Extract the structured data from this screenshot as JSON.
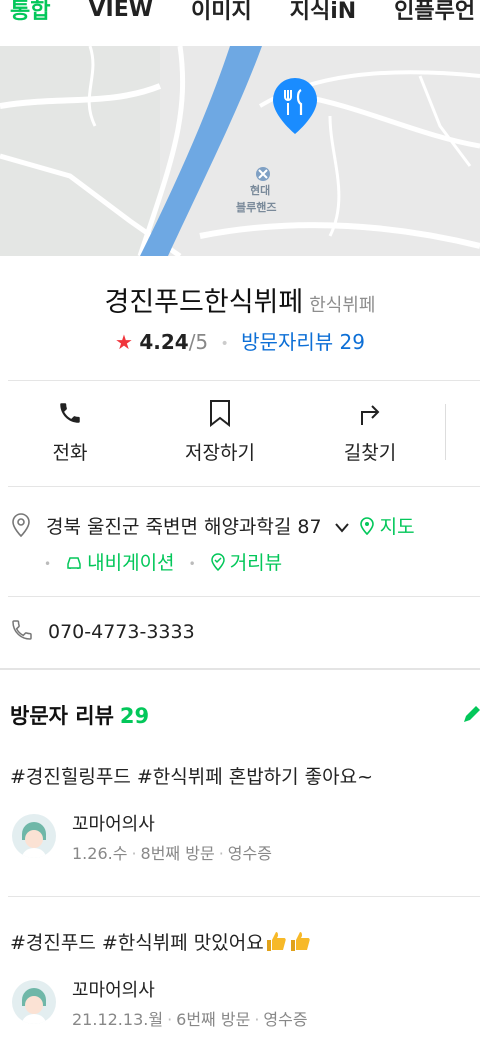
{
  "tabs": [
    "통합",
    "VIEW",
    "이미지",
    "지식iN",
    "인플루언"
  ],
  "map": {
    "label_line1": "현대",
    "label_line2": "블루핸즈"
  },
  "place": {
    "name": "경진푸드한식뷔페",
    "category": "한식뷔페",
    "rating": "4.24",
    "rating_max": "/5",
    "visitor_reviews": "방문자리뷰 29"
  },
  "actions": {
    "call": "전화",
    "save": "저장하기",
    "directions": "길찾기"
  },
  "address": {
    "text": "경북 울진군 죽변면 해양과학길 87",
    "map_link": "지도",
    "navigation": "내비게이션",
    "street_view": "거리뷰"
  },
  "phone": "070-4773-3333",
  "reviews": {
    "header": "방문자 리뷰",
    "count": "29",
    "items": [
      {
        "text": "#경진힐링푸드 #한식뷔페 혼밥하기 좋아요~",
        "author": "꼬마어의사",
        "date": "1.26.수",
        "visit": "8번째 방문",
        "receipt": "영수증"
      },
      {
        "text": "#경진푸드 #한식뷔페 맛있어요",
        "author": "꼬마어의사",
        "date": "21.12.13.월",
        "visit": "6번째 방문",
        "receipt": "영수증"
      }
    ]
  },
  "colors": {
    "accent_green": "#03c75a",
    "link_blue": "#0d6fd6",
    "star_red": "#f0353c",
    "map_pin": "#1a8cff"
  }
}
